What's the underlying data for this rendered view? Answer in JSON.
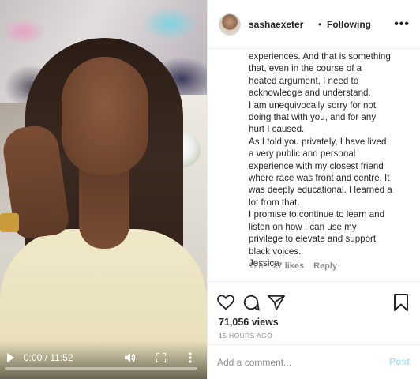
{
  "video": {
    "current_time": "0:00",
    "duration": "11:52",
    "time_separator": "/",
    "progress_fraction": 0,
    "icons": [
      "play-icon",
      "volume-icon",
      "fullscreen-icon",
      "more-vertical-icon"
    ]
  },
  "post": {
    "username": "sashaexeter",
    "separator": "•",
    "follow_status": "Following",
    "more_label": "•••"
  },
  "comment": {
    "lines": [
      "experiences. And that is something",
      "that, even in the course of a",
      "heated argument, I need to",
      "acknowledge and understand.",
      "I am unequivocally sorry for not",
      "doing that with you, and for any",
      "hurt I caused.",
      "As I told you privately, I have lived",
      "a very public and personal",
      "experience with my closest friend",
      "where race was front and centre. It",
      "was deeply educational. I learned a",
      "lot from that.",
      "I promise to continue to learn and",
      "listen on how I can use my",
      "privilege to elevate and support",
      "black voices.",
      "Jessica"
    ],
    "age": "12h",
    "likes": "27 likes",
    "reply_label": "Reply"
  },
  "actions": {
    "icons": [
      "heart-icon",
      "comment-icon",
      "share-icon",
      "bookmark-icon"
    ],
    "views": "71,056 views",
    "timestamp": "15 HOURS AGO"
  },
  "add_comment": {
    "placeholder": "Add a comment...",
    "post_label": "Post"
  },
  "colors": {
    "text": "#262626",
    "muted": "#8e8e8e",
    "border": "#efefef",
    "post_disabled": "#b2dffc"
  }
}
